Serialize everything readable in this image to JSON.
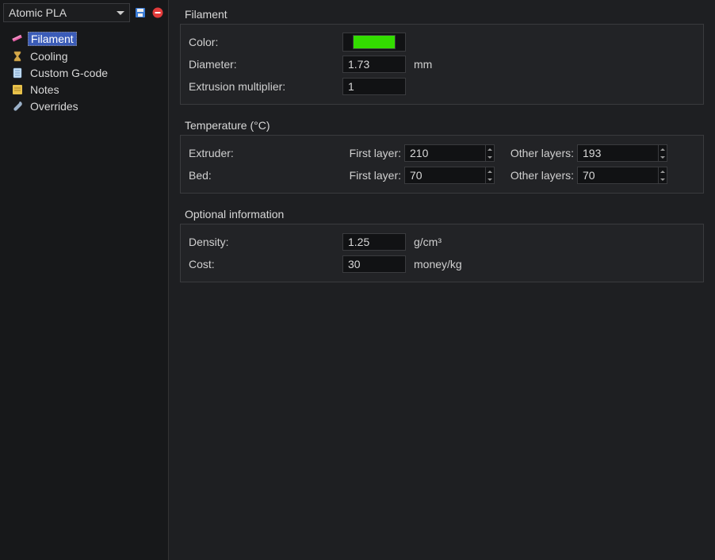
{
  "toolbar": {
    "preset_name": "Atomic PLA"
  },
  "sidebar": {
    "items": [
      {
        "label": "Filament",
        "icon": "spool"
      },
      {
        "label": "Cooling",
        "icon": "hourglass"
      },
      {
        "label": "Custom G-code",
        "icon": "document"
      },
      {
        "label": "Notes",
        "icon": "note"
      },
      {
        "label": "Overrides",
        "icon": "wrench"
      }
    ]
  },
  "sections": {
    "filament": {
      "title": "Filament",
      "color_label": "Color:",
      "color_value": "#33dd00",
      "diameter_label": "Diameter:",
      "diameter_value": "1.73",
      "diameter_unit": "mm",
      "extrusion_label": "Extrusion multiplier:",
      "extrusion_value": "1"
    },
    "temperature": {
      "title": "Temperature (°C)",
      "extruder_label": "Extruder:",
      "bed_label": "Bed:",
      "first_layer_label": "First layer:",
      "other_layers_label": "Other layers:",
      "extruder_first": "210",
      "extruder_other": "193",
      "bed_first": "70",
      "bed_other": "70"
    },
    "optional": {
      "title": "Optional information",
      "density_label": "Density:",
      "density_value": "1.25",
      "density_unit": "g/cm³",
      "cost_label": "Cost:",
      "cost_value": "30",
      "cost_unit": "money/kg"
    }
  }
}
